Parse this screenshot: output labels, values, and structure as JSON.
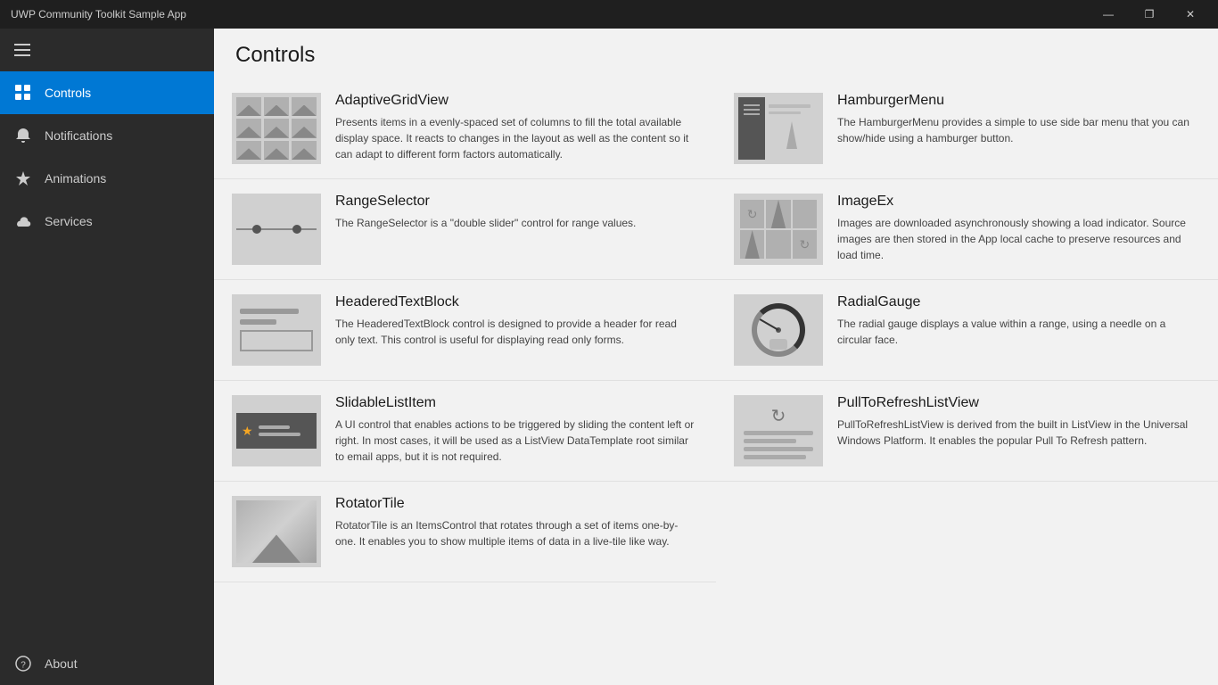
{
  "titleBar": {
    "title": "UWP Community Toolkit Sample App",
    "minimize": "—",
    "restore": "❐",
    "close": "✕"
  },
  "sidebar": {
    "hamburger": "☰",
    "items": [
      {
        "id": "controls",
        "label": "Controls",
        "icon": "grid",
        "active": true
      },
      {
        "id": "notifications",
        "label": "Notifications",
        "icon": "bell",
        "active": false
      },
      {
        "id": "animations",
        "label": "Animations",
        "icon": "sparkle",
        "active": false
      },
      {
        "id": "services",
        "label": "Services",
        "icon": "cloud",
        "active": false
      }
    ],
    "bottom": [
      {
        "id": "about",
        "label": "About",
        "icon": "question"
      }
    ]
  },
  "page": {
    "title": "Controls"
  },
  "controls": [
    {
      "name": "AdaptiveGridView",
      "description": "Presents items in a evenly-spaced set of columns to fill the total available display space. It reacts to changes in the layout as well as the content so it can adapt to different form factors automatically.",
      "thumb": "adaptive-grid"
    },
    {
      "name": "HamburgerMenu",
      "description": "The HamburgerMenu provides a simple to use side bar menu that you can show/hide using a hamburger button.",
      "thumb": "hamburger-menu"
    },
    {
      "name": "RangeSelector",
      "description": "The RangeSelector is a \"double slider\" control for range values.",
      "thumb": "range-selector"
    },
    {
      "name": "ImageEx",
      "description": "Images are downloaded asynchronously showing a load indicator. Source images are then stored in the App local cache to preserve resources and load time.",
      "thumb": "image-ex"
    },
    {
      "name": "HeaderedTextBlock",
      "description": "The HeaderedTextBlock control is designed to provide a header for read only text. This control is useful for displaying read only forms.",
      "thumb": "headered-text-block"
    },
    {
      "name": "RadialGauge",
      "description": "The radial gauge displays a value within a range, using a needle on a circular face.",
      "thumb": "radial-gauge"
    },
    {
      "name": "SlidableListItem",
      "description": "A UI control that enables actions to be triggered by sliding the content left or right. In most cases, it will be used as a ListView DataTemplate root similar to email apps, but it is not required.",
      "thumb": "slidable-list-item"
    },
    {
      "name": "PullToRefreshListView",
      "description": "PullToRefreshListView is derived from the built in ListView in the Universal Windows Platform. It enables the popular Pull To Refresh pattern.",
      "thumb": "pull-to-refresh"
    },
    {
      "name": "RotatorTile",
      "description": "RotatorTile is an ItemsControl that rotates through a set of items one-by-one. It enables you to show multiple items of data in a live-tile like way.",
      "thumb": "rotator-tile"
    }
  ]
}
